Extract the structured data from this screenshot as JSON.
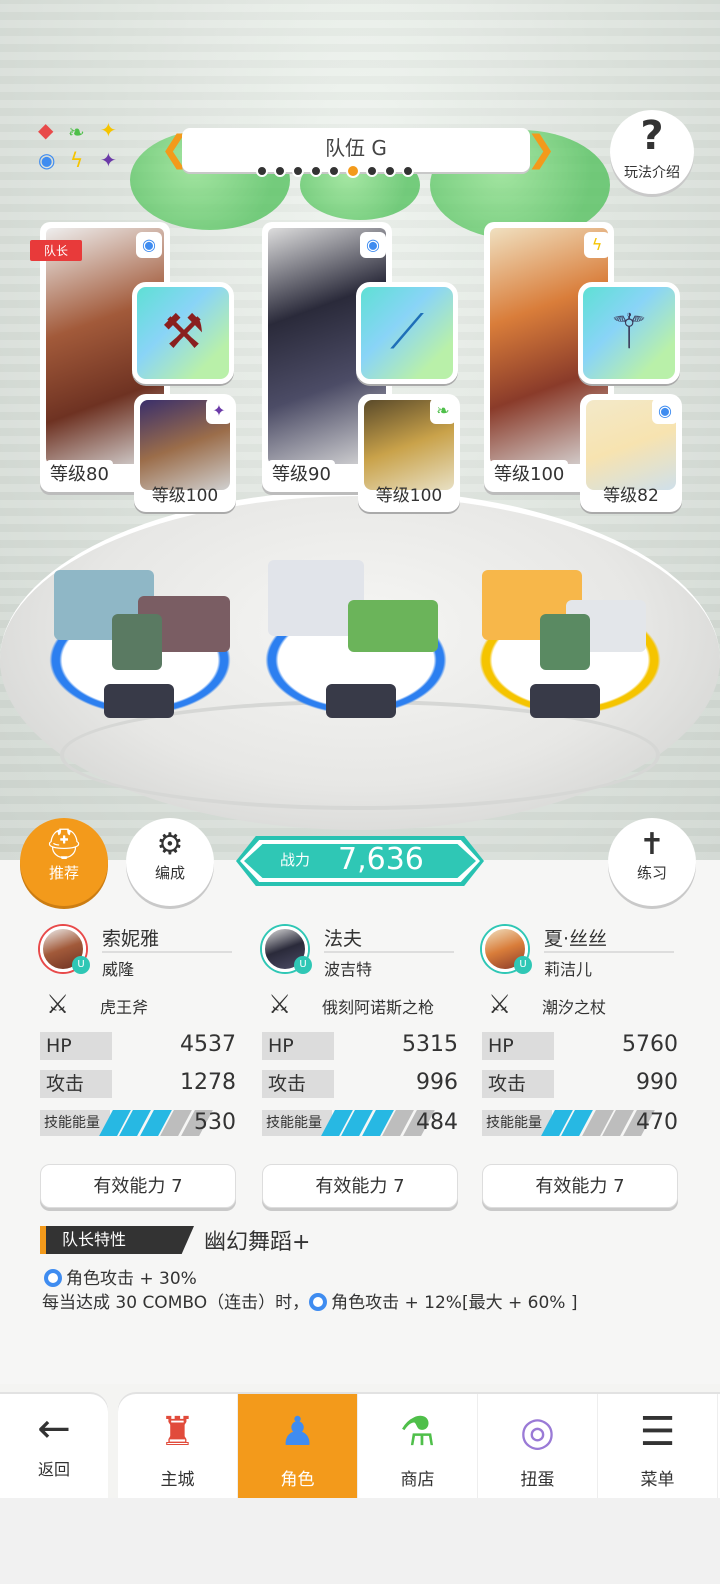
{
  "header": {
    "team_name": "队伍 G",
    "page_count": 9,
    "active_page": 6,
    "help_label": "玩法介绍"
  },
  "cards": [
    {
      "leader": true,
      "leader_label": "队长",
      "level": "等级80",
      "element": "water",
      "weapon_icon": "axe-icon",
      "sub_level": "等级100",
      "sub_element": "dark"
    },
    {
      "leader": false,
      "level": "等级90",
      "element": "water",
      "weapon_icon": "spear-icon",
      "sub_level": "等级100",
      "sub_element": "wood"
    },
    {
      "leader": false,
      "level": "等级100",
      "element": "thunder",
      "weapon_icon": "staff-icon",
      "sub_level": "等级82",
      "sub_element": "water"
    }
  ],
  "buttons": {
    "recommend": "推荐",
    "edit": "编成",
    "practice": "练习"
  },
  "power": {
    "label": "战力",
    "value": "7,636"
  },
  "stats_labels": {
    "hp": "HP",
    "atk": "攻击",
    "energy": "技能能量"
  },
  "characters": [
    {
      "name": "索妮雅",
      "unison": "威隆",
      "weapon": "虎王斧",
      "hp": "4537",
      "atk": "1278",
      "energy": "530",
      "energy_fill": 0.6,
      "ability": "有效能力 7"
    },
    {
      "name": "法夫",
      "unison": "波吉特",
      "weapon": "俄刻阿诺斯之枪",
      "hp": "5315",
      "atk": "996",
      "energy": "484",
      "energy_fill": 0.6,
      "ability": "有效能力 7"
    },
    {
      "name": "夏·丝丝",
      "unison": "莉洁儿",
      "weapon": "潮汐之杖",
      "hp": "5760",
      "atk": "990",
      "energy": "470",
      "energy_fill": 0.4,
      "ability": "有效能力 7"
    }
  ],
  "leader_skill": {
    "tag": "队长特性",
    "name": "幽幻舞蹈+",
    "line1": "角色攻击 + 30%",
    "line2_prefix": "每当达成 30 COMBO（连击）时，",
    "line2_suffix": "角色攻击 + 12%[最大 + 60% ]"
  },
  "nav": {
    "back": "返回",
    "items": [
      {
        "label": "主城",
        "icon": "castle-icon"
      },
      {
        "label": "角色",
        "icon": "character-icon",
        "active": true
      },
      {
        "label": "商店",
        "icon": "shop-icon"
      },
      {
        "label": "扭蛋",
        "icon": "gacha-icon"
      },
      {
        "label": "菜单",
        "icon": "menu-icon"
      }
    ]
  },
  "colors": {
    "accent": "#f39a1b",
    "teal": "#2fc7b5",
    "energy": "#27b8e3",
    "water": "#3f8cf0"
  }
}
